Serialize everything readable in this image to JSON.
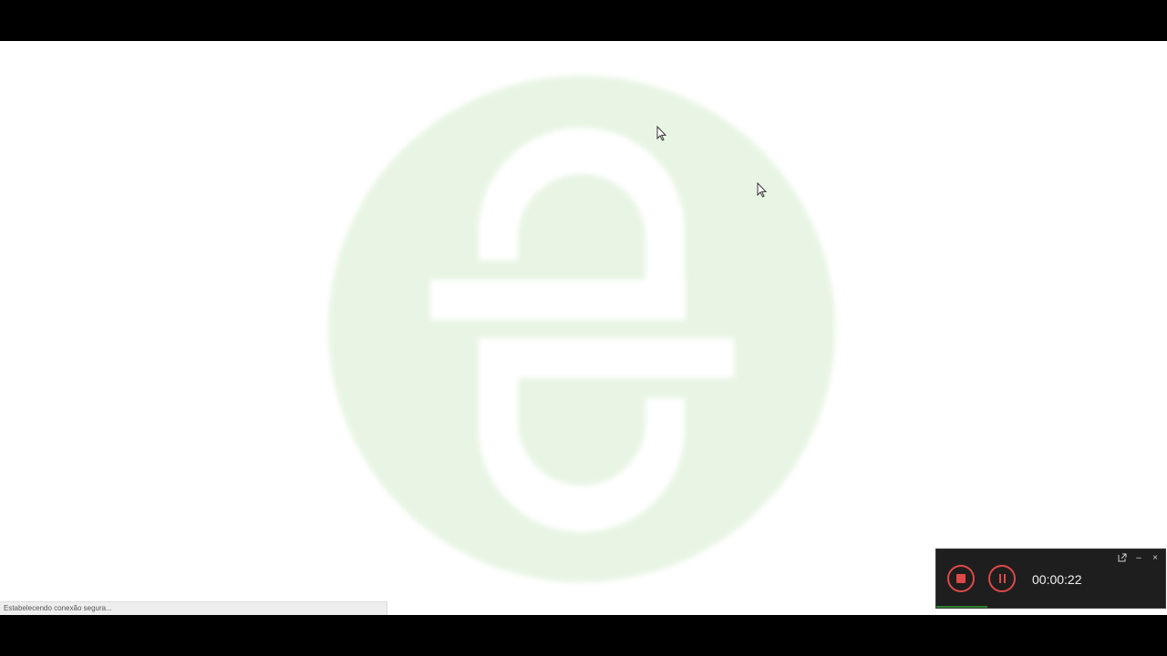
{
  "browser": {
    "status_text": "Estabelecendo conexão segura..."
  },
  "logo": {
    "icon": "edpuzzle-style-e-logo-icon",
    "circle_color": "#e8f5e4",
    "glyph_color": "#ffffff"
  },
  "recorder": {
    "timer": "00:00:22",
    "accent_color": "#e04848",
    "icons": {
      "stop": "stop-icon",
      "pause": "pause-icon",
      "popout": "popout-icon",
      "minimize": "minimize-icon",
      "close": "close-icon"
    },
    "minimize_glyph": "–",
    "close_glyph": "×"
  }
}
